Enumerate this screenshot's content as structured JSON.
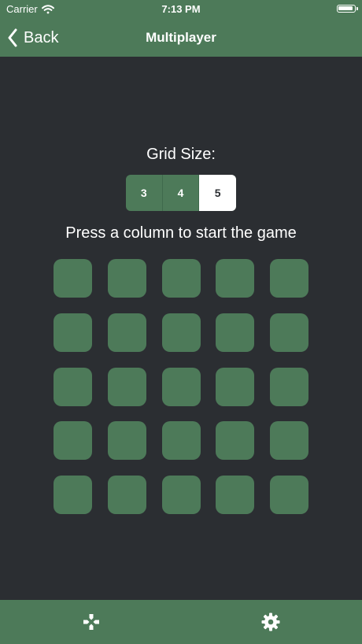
{
  "status_bar": {
    "carrier": "Carrier",
    "time": "7:13 PM"
  },
  "navigation": {
    "back_label": "Back",
    "title": "Multiplayer"
  },
  "grid_size": {
    "label": "Grid Size:",
    "options": [
      "3",
      "4",
      "5"
    ],
    "selected": "5"
  },
  "instructions": "Press a column to start the game",
  "board": {
    "rows": 5,
    "columns": 5
  },
  "tab_bar": {
    "items": [
      {
        "icon": "gamepad-icon"
      },
      {
        "icon": "gear-icon"
      }
    ]
  },
  "colors": {
    "background": "#2b2e32",
    "accent": "#4d7a59",
    "text": "#ffffff"
  }
}
